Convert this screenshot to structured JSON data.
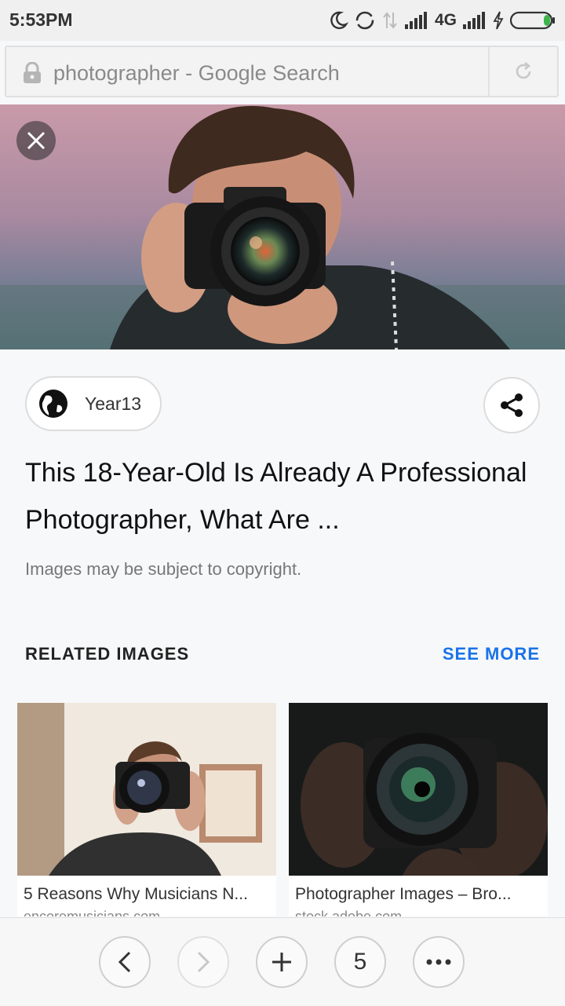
{
  "status_bar": {
    "time": "5:53PM",
    "network": "4G",
    "icons": [
      "moon-icon",
      "sync-icon",
      "data-arrows-icon",
      "signal-icon",
      "signal-icon",
      "charging-icon",
      "battery-icon"
    ]
  },
  "address_bar": {
    "url_text": "photographer - Google Search",
    "icons": [
      "lock-icon",
      "reload-icon"
    ]
  },
  "preview": {
    "close_icon": "close-icon",
    "source_name": "Year13",
    "source_icon": "globe-icon",
    "share_icon": "share-icon",
    "title": "This 18-Year-Old Is Already A Professional Photographer, What Are ...",
    "copyright": "Images may be subject to copyright."
  },
  "related": {
    "heading": "RELATED IMAGES",
    "see_more": "SEE MORE",
    "items": [
      {
        "title": "5 Reasons Why Musicians N...",
        "domain": "encoremusicians.com"
      },
      {
        "title": "Photographer Images – Bro...",
        "domain": "stock.adobe.com"
      }
    ]
  },
  "bottom_nav": {
    "tab_count": "5",
    "icons": [
      "back-icon",
      "forward-icon",
      "new-tab-icon",
      "more-icon"
    ]
  },
  "colors": {
    "accent": "#1a73e8",
    "background": "#f7f8fa"
  }
}
